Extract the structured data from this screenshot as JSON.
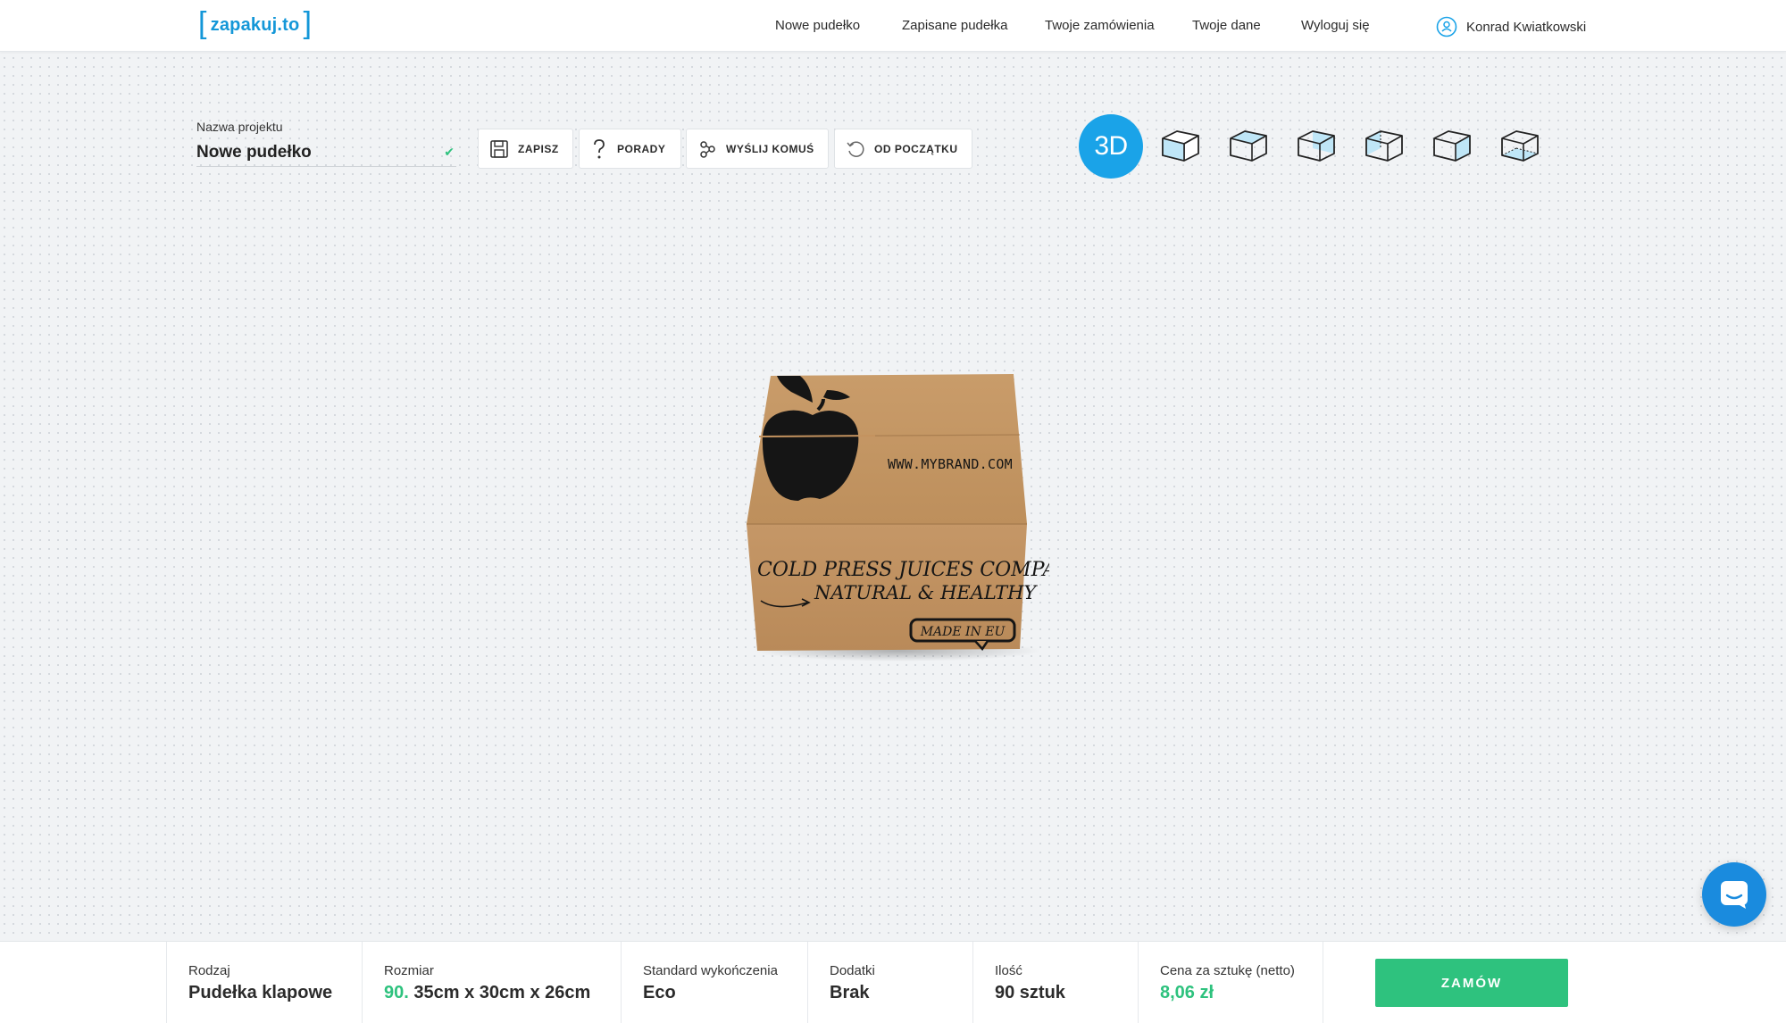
{
  "header": {
    "logo_text": "zapakuj.to",
    "nav": [
      "Nowe pudełko",
      "Zapisane pudełka",
      "Twoje zamówienia",
      "Twoje dane",
      "Wyloguj się"
    ],
    "user_name": "Konrad Kwiatkowski"
  },
  "project": {
    "label": "Nazwa projektu",
    "name": "Nowe pudełko"
  },
  "toolbar": {
    "save": "ZAPISZ",
    "tips": "PORADY",
    "share": "WYŚLIJ KOMUŚ",
    "reset": "OD POCZĄTKU"
  },
  "views": {
    "active": "3D",
    "icons": [
      "box-front-view-icon",
      "box-top-view-icon",
      "box-side-view-icon",
      "box-back-view-icon",
      "box-other-side-view-icon",
      "box-bottom-view-icon"
    ]
  },
  "box_print": {
    "website": "WWW.MYBRAND.COM",
    "line1": "COLD PRESS JUICES COMPANY",
    "line2": "NATURAL & HEALTHY",
    "badge": "MADE IN EU"
  },
  "footer": {
    "type_label": "Rodzaj",
    "type_value": "Pudełka klapowe",
    "size_label": "Rozmiar",
    "size_qty": "90.",
    "size_value": "35cm x 30cm x 26cm",
    "finish_label": "Standard wykończenia",
    "finish_value": "Eco",
    "extras_label": "Dodatki",
    "extras_value": "Brak",
    "amount_label": "Ilość",
    "amount_value": "90 sztuk",
    "price_label": "Cena za sztukę (netto)",
    "price_value": "8,06 zł",
    "order_button": "ZAMÓW"
  },
  "colors": {
    "accent_blue": "#1aa3e8",
    "accent_green": "#2ec27e",
    "cardboard": "#c4935f"
  }
}
